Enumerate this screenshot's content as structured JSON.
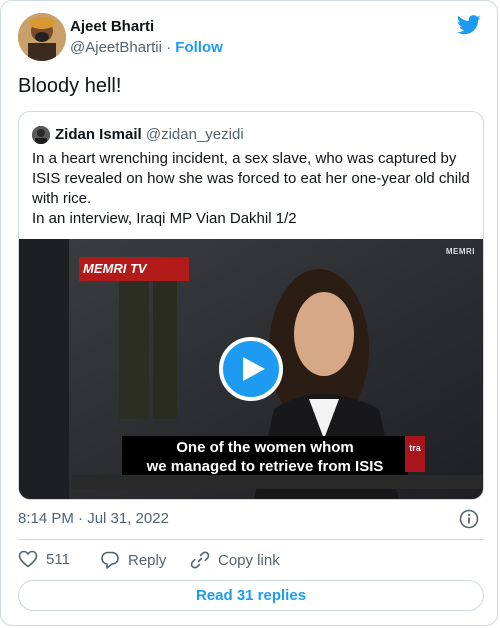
{
  "author": {
    "name": "Ajeet Bharti",
    "handle": "@AjeetBhartii",
    "separator": "·",
    "follow_label": "Follow"
  },
  "tweet_text": "Bloody hell!",
  "quoted_tweet": {
    "name": "Zidan Ismail",
    "handle": "@zidan_yezidi",
    "text_line1": "In a heart wrenching incident, a sex slave, who was captured by ISIS revealed on how she was forced to eat her one-year old child with rice.",
    "text_line2": "In an interview, Iraqi MP Vian Dakhil 1/2",
    "video": {
      "watermark": "MEMRI",
      "logo_text": "MEMRI TV",
      "subtitle_line1": "One of the women whom",
      "subtitle_line2": "we managed to retrieve from ISIS",
      "side_tag": "tra"
    }
  },
  "timestamp": "8:14 PM · Jul 31, 2022",
  "actions": {
    "like_count": "511",
    "reply_label": "Reply",
    "copy_link_label": "Copy link"
  },
  "read_replies_label": "Read 31 replies",
  "colors": {
    "accent": "#1d9bf0",
    "secondary_text": "#536471",
    "border": "#cfd9de"
  },
  "icons": [
    "twitter-bird-icon",
    "play-icon",
    "info-icon",
    "heart-icon",
    "reply-icon",
    "link-icon"
  ]
}
